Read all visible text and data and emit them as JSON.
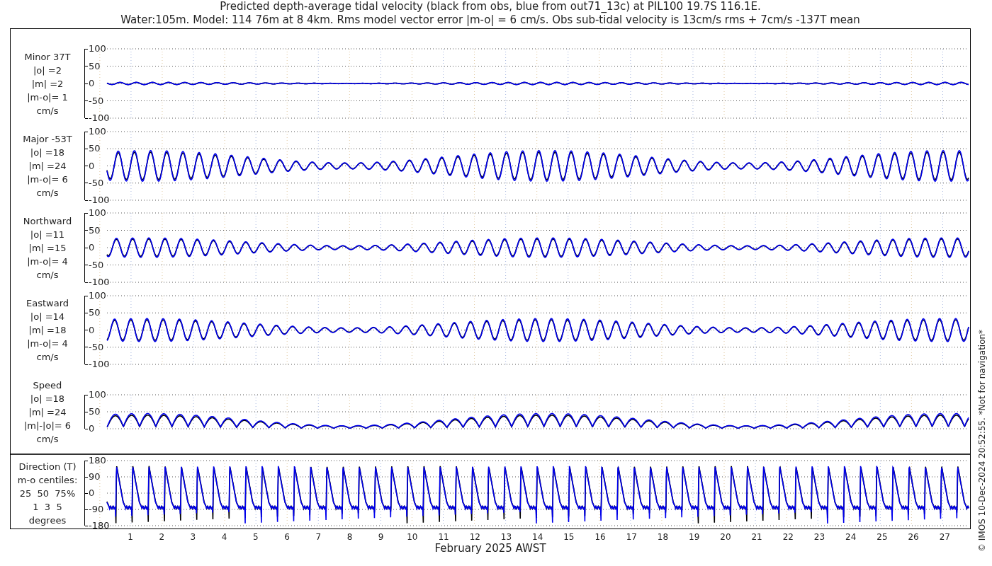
{
  "title": {
    "line_1": "Predicted depth-average tidal velocity (black from obs, blue from out71_13c) at PIL100 19.7S 116.1E.",
    "line_2": "Water:105m. Model: 114 76m at 8 4km. Rms model vector error |m-o| = 6 cm/s. Obs sub-tidal velocity is 13cm/s rms + 7cm/s -137T mean"
  },
  "panels": [
    {
      "kind": "component",
      "label_lines": [
        "Minor 37T",
        "|o| =2",
        "|m| =2",
        "|m-o|= 1",
        "cm/s"
      ],
      "yticks": [
        "100",
        "50",
        "0",
        "-50",
        "-100"
      ]
    },
    {
      "kind": "component",
      "label_lines": [
        "Major -53T",
        "|o| =18",
        "|m| =24",
        "|m-o|= 6",
        "cm/s"
      ],
      "yticks": [
        "100",
        "50",
        "0",
        "-50",
        "-100"
      ]
    },
    {
      "kind": "component",
      "label_lines": [
        "Northward",
        "|o| =11",
        "|m| =15",
        "|m-o|= 4",
        "cm/s"
      ],
      "yticks": [
        "100",
        "50",
        "0",
        "-50",
        "-100"
      ]
    },
    {
      "kind": "component",
      "label_lines": [
        "Eastward",
        "|o| =14",
        "|m| =18",
        "|m-o|= 4",
        "cm/s"
      ],
      "yticks": [
        "100",
        "50",
        "0",
        "-50",
        "-100"
      ]
    },
    {
      "kind": "speed",
      "label_lines": [
        "Speed",
        "|o| =18",
        "|m| =24",
        "|m|-|o|= 6",
        "cm/s"
      ],
      "yticks": [
        "100",
        "50",
        "0"
      ]
    }
  ],
  "direction_panel": {
    "kind": "direction",
    "label_lines": [
      "Direction (T)",
      "m-o centiles:",
      "25  50  75%",
      "1  3  5",
      "degrees"
    ],
    "yticks": [
      "180",
      "90",
      "0",
      "-90",
      "-180"
    ]
  },
  "x_axis": {
    "ticks": [
      "1",
      "2",
      "3",
      "4",
      "5",
      "6",
      "7",
      "8",
      "9",
      "10",
      "11",
      "12",
      "13",
      "14",
      "15",
      "16",
      "17",
      "18",
      "19",
      "20",
      "21",
      "22",
      "23",
      "24",
      "25",
      "26",
      "27"
    ],
    "label": "February 2025 AWST"
  },
  "side_note": "© IMOS 10-Dec-2024 20:52:55. *Not for navigation*"
}
